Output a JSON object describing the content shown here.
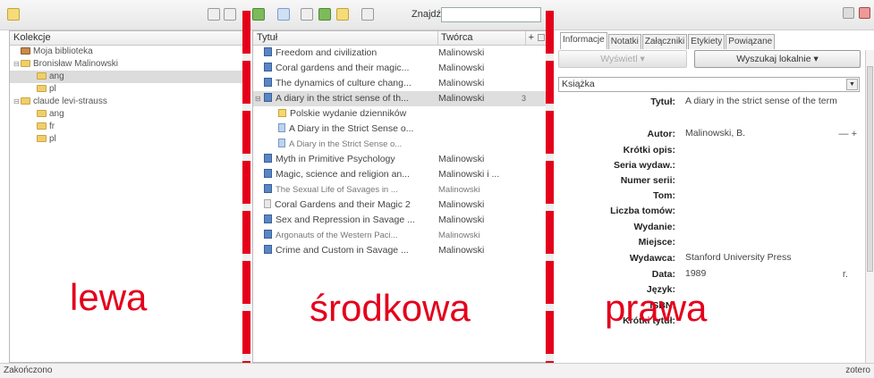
{
  "toolbar": {
    "search_label": "Znajdź:",
    "search_value": ""
  },
  "left_pane": {
    "header": "Kolekcje",
    "tree": [
      {
        "label": "Moja biblioteka",
        "level": 0,
        "icon": "library-icon",
        "twisty": ""
      },
      {
        "label": "Bronisław Malinowski",
        "level": 0,
        "icon": "folder-icon",
        "twisty": "⊟"
      },
      {
        "label": "ang",
        "level": 1,
        "icon": "folder-icon",
        "twisty": "",
        "selected": true
      },
      {
        "label": "pl",
        "level": 1,
        "icon": "folder-icon",
        "twisty": ""
      },
      {
        "label": "claude levi-strauss",
        "level": 0,
        "icon": "folder-icon",
        "twisty": "⊟"
      },
      {
        "label": "ang",
        "level": 1,
        "icon": "folder-icon",
        "twisty": ""
      },
      {
        "label": "fr",
        "level": 1,
        "icon": "folder-icon",
        "twisty": ""
      },
      {
        "label": "pl",
        "level": 1,
        "icon": "folder-icon",
        "twisty": ""
      }
    ],
    "big_label": "lewa"
  },
  "middle_pane": {
    "col_title": "Tytuł",
    "col_creator": "Twórca",
    "col_picker": "+",
    "items": [
      {
        "title": "Freedom and civilization",
        "creator": "Malinowski",
        "icon": "book"
      },
      {
        "title": "Coral gardens and their magic...",
        "creator": "Malinowski",
        "icon": "book"
      },
      {
        "title": "The dynamics of culture chang...",
        "creator": "Malinowski",
        "icon": "book"
      },
      {
        "title": "A diary in the strict sense of th...",
        "creator": "Malinowski",
        "icon": "book",
        "selected": true,
        "extra": "3"
      },
      {
        "title": "Polskie wydanie dzienników",
        "creator": "",
        "icon": "note",
        "child": true
      },
      {
        "title": "A Diary in the Strict Sense o...",
        "creator": "",
        "icon": "pdf",
        "child": true
      },
      {
        "title": "A Diary in the Strict Sense o...",
        "creator": "",
        "icon": "pdf",
        "child": true,
        "faint": true
      },
      {
        "title": "Myth in Primitive Psychology",
        "creator": "Malinowski",
        "icon": "book"
      },
      {
        "title": "Magic, science and religion an...",
        "creator": "Malinowski i ...",
        "icon": "book"
      },
      {
        "title": "The Sexual Life of Savages in ...",
        "creator": "Malinowski",
        "icon": "book",
        "faint": true
      },
      {
        "title": "Coral Gardens and their Magic 2",
        "creator": "Malinowski",
        "icon": "doc"
      },
      {
        "title": "Sex and Repression in Savage ...",
        "creator": "Malinowski",
        "icon": "book"
      },
      {
        "title": "Argonauts of the Western Paci...",
        "creator": "Malinowski",
        "icon": "book",
        "faint": true
      },
      {
        "title": "Crime and Custom in Savage ...",
        "creator": "Malinowski",
        "icon": "book"
      }
    ],
    "big_label": "środkowa"
  },
  "right_pane": {
    "tabs": [
      "Informacje",
      "Notatki",
      "Załączniki",
      "Etykiety",
      "Powiązane"
    ],
    "view_button": "Wyświetl ▾",
    "locate_button": "Wyszukaj lokalnie ▾",
    "item_type": "Książka",
    "fields": [
      {
        "label": "Tytuł:",
        "value": "A diary in the strict sense of the term"
      },
      {
        "label": "Autor:",
        "value": "Malinowski,  B."
      },
      {
        "label": "Krótki opis:",
        "value": ""
      },
      {
        "label": "Seria wydaw.:",
        "value": ""
      },
      {
        "label": "Numer serii:",
        "value": ""
      },
      {
        "label": "Tom:",
        "value": ""
      },
      {
        "label": "Liczba tomów:",
        "value": ""
      },
      {
        "label": "Wydanie:",
        "value": ""
      },
      {
        "label": "Miejsce:",
        "value": ""
      },
      {
        "label": "Wydawca:",
        "value": "Stanford University Press"
      },
      {
        "label": "Data:",
        "value": "1989"
      },
      {
        "label": "Język:",
        "value": ""
      },
      {
        "label": "ISBN:",
        "value": ""
      },
      {
        "label": "Krótki tytuł:",
        "value": ""
      }
    ],
    "date_suffix": "r.",
    "author_controls": "— +",
    "big_label": "prawa"
  },
  "status": {
    "left": "Zakończono",
    "right": "zotero"
  },
  "colors": {
    "accent_red": "#e4001b",
    "selection": "#dcdcdc"
  }
}
